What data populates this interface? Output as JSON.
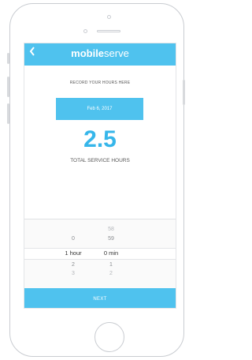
{
  "header": {
    "back_icon": "chevron-left-icon",
    "brand_bold": "mobile",
    "brand_light": "serve"
  },
  "form": {
    "prompt": "RECORD YOUR HOURS HERE",
    "date": "Feb 6, 2017"
  },
  "summary": {
    "total": "2.5",
    "label": "TOTAL SERVICE HOURS"
  },
  "picker": {
    "hours": {
      "above_2": "",
      "above_1": "0",
      "selected": "1 hour",
      "below_1": "2",
      "below_2": "3"
    },
    "minutes": {
      "above_2": "58",
      "above_1": "59",
      "selected": "0 min",
      "below_1": "1",
      "below_2": "2"
    }
  },
  "footer": {
    "next_label": "NEXT"
  },
  "colors": {
    "accent": "#4fc2ee",
    "total_text": "#36b6ea"
  }
}
